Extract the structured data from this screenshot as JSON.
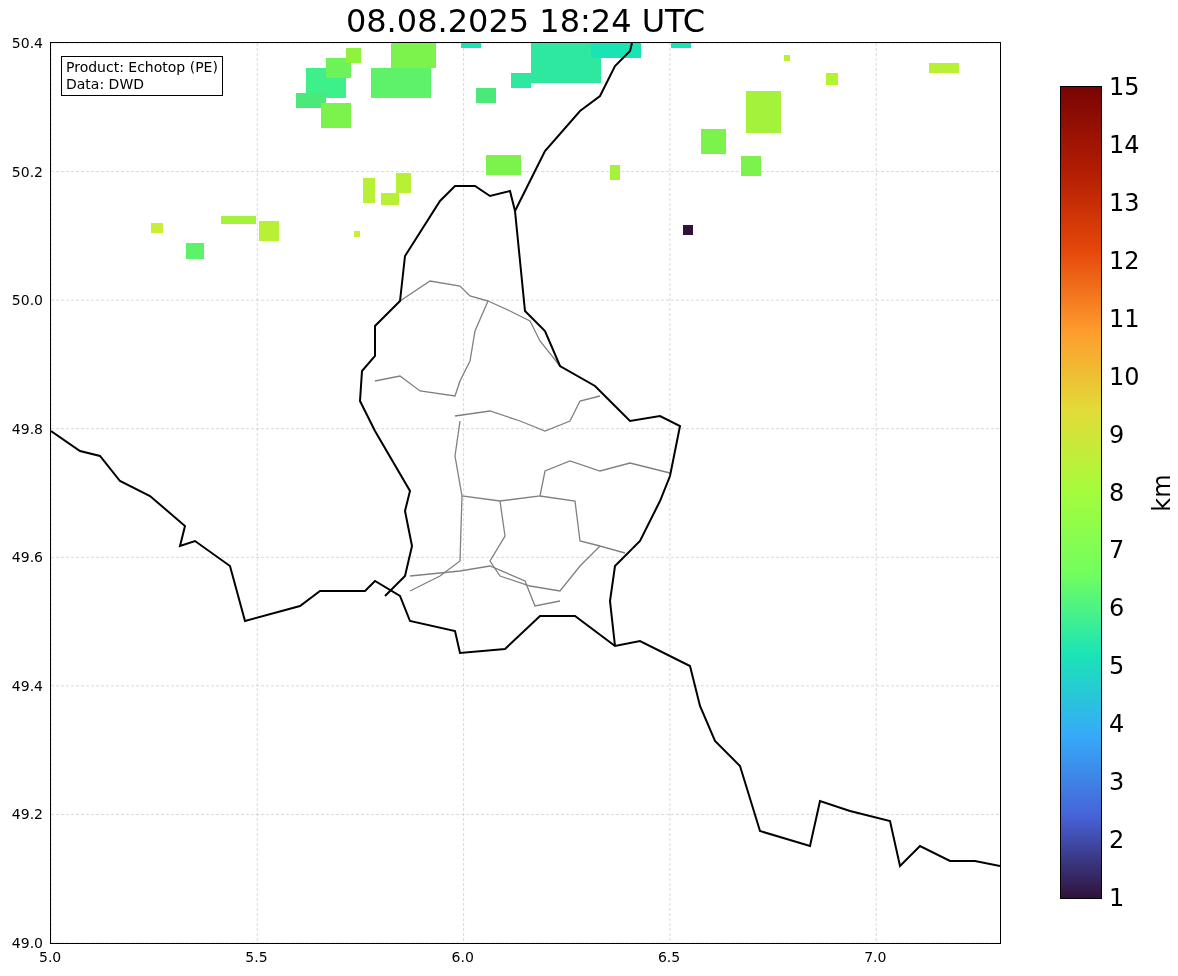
{
  "title": "08.08.2025 18:24 UTC",
  "info_box": [
    "Product: Echotop (PE)",
    "Data: DWD"
  ],
  "y_ticks": [
    "50.4",
    "50.2",
    "50.0",
    "49.8",
    "49.6",
    "49.4",
    "49.2",
    "49.0"
  ],
  "x_ticks": [
    "5.0",
    "5.5",
    "6.0",
    "6.5",
    "7.0"
  ],
  "colorbar": {
    "label": "km",
    "ticks": [
      "15",
      "14",
      "13",
      "12",
      "11",
      "10",
      "9",
      "8",
      "7",
      "6",
      "5",
      "4",
      "3",
      "2",
      "1"
    ]
  }
}
